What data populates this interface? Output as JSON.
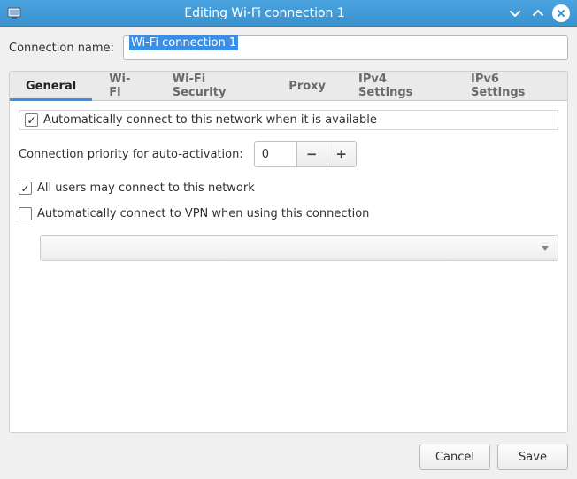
{
  "titlebar": {
    "title": "Editing Wi-Fi connection 1"
  },
  "connection_name": {
    "label": "Connection name:",
    "value": "Wi-Fi connection 1"
  },
  "tabs": [
    {
      "label": "General"
    },
    {
      "label": "Wi-Fi"
    },
    {
      "label": "Wi-Fi Security"
    },
    {
      "label": "Proxy"
    },
    {
      "label": "IPv4 Settings"
    },
    {
      "label": "IPv6 Settings"
    }
  ],
  "active_tab_index": 0,
  "general": {
    "auto_connect": {
      "label": "Automatically connect to this network when it is available",
      "checked": true
    },
    "priority": {
      "label": "Connection priority for auto-activation:",
      "value": "0"
    },
    "all_users": {
      "label": "All users may connect to this network",
      "checked": true
    },
    "auto_vpn": {
      "label": "Automatically connect to VPN when using this connection",
      "checked": false
    },
    "vpn_combo": {
      "selected": ""
    }
  },
  "buttons": {
    "cancel": "Cancel",
    "save": "Save"
  }
}
